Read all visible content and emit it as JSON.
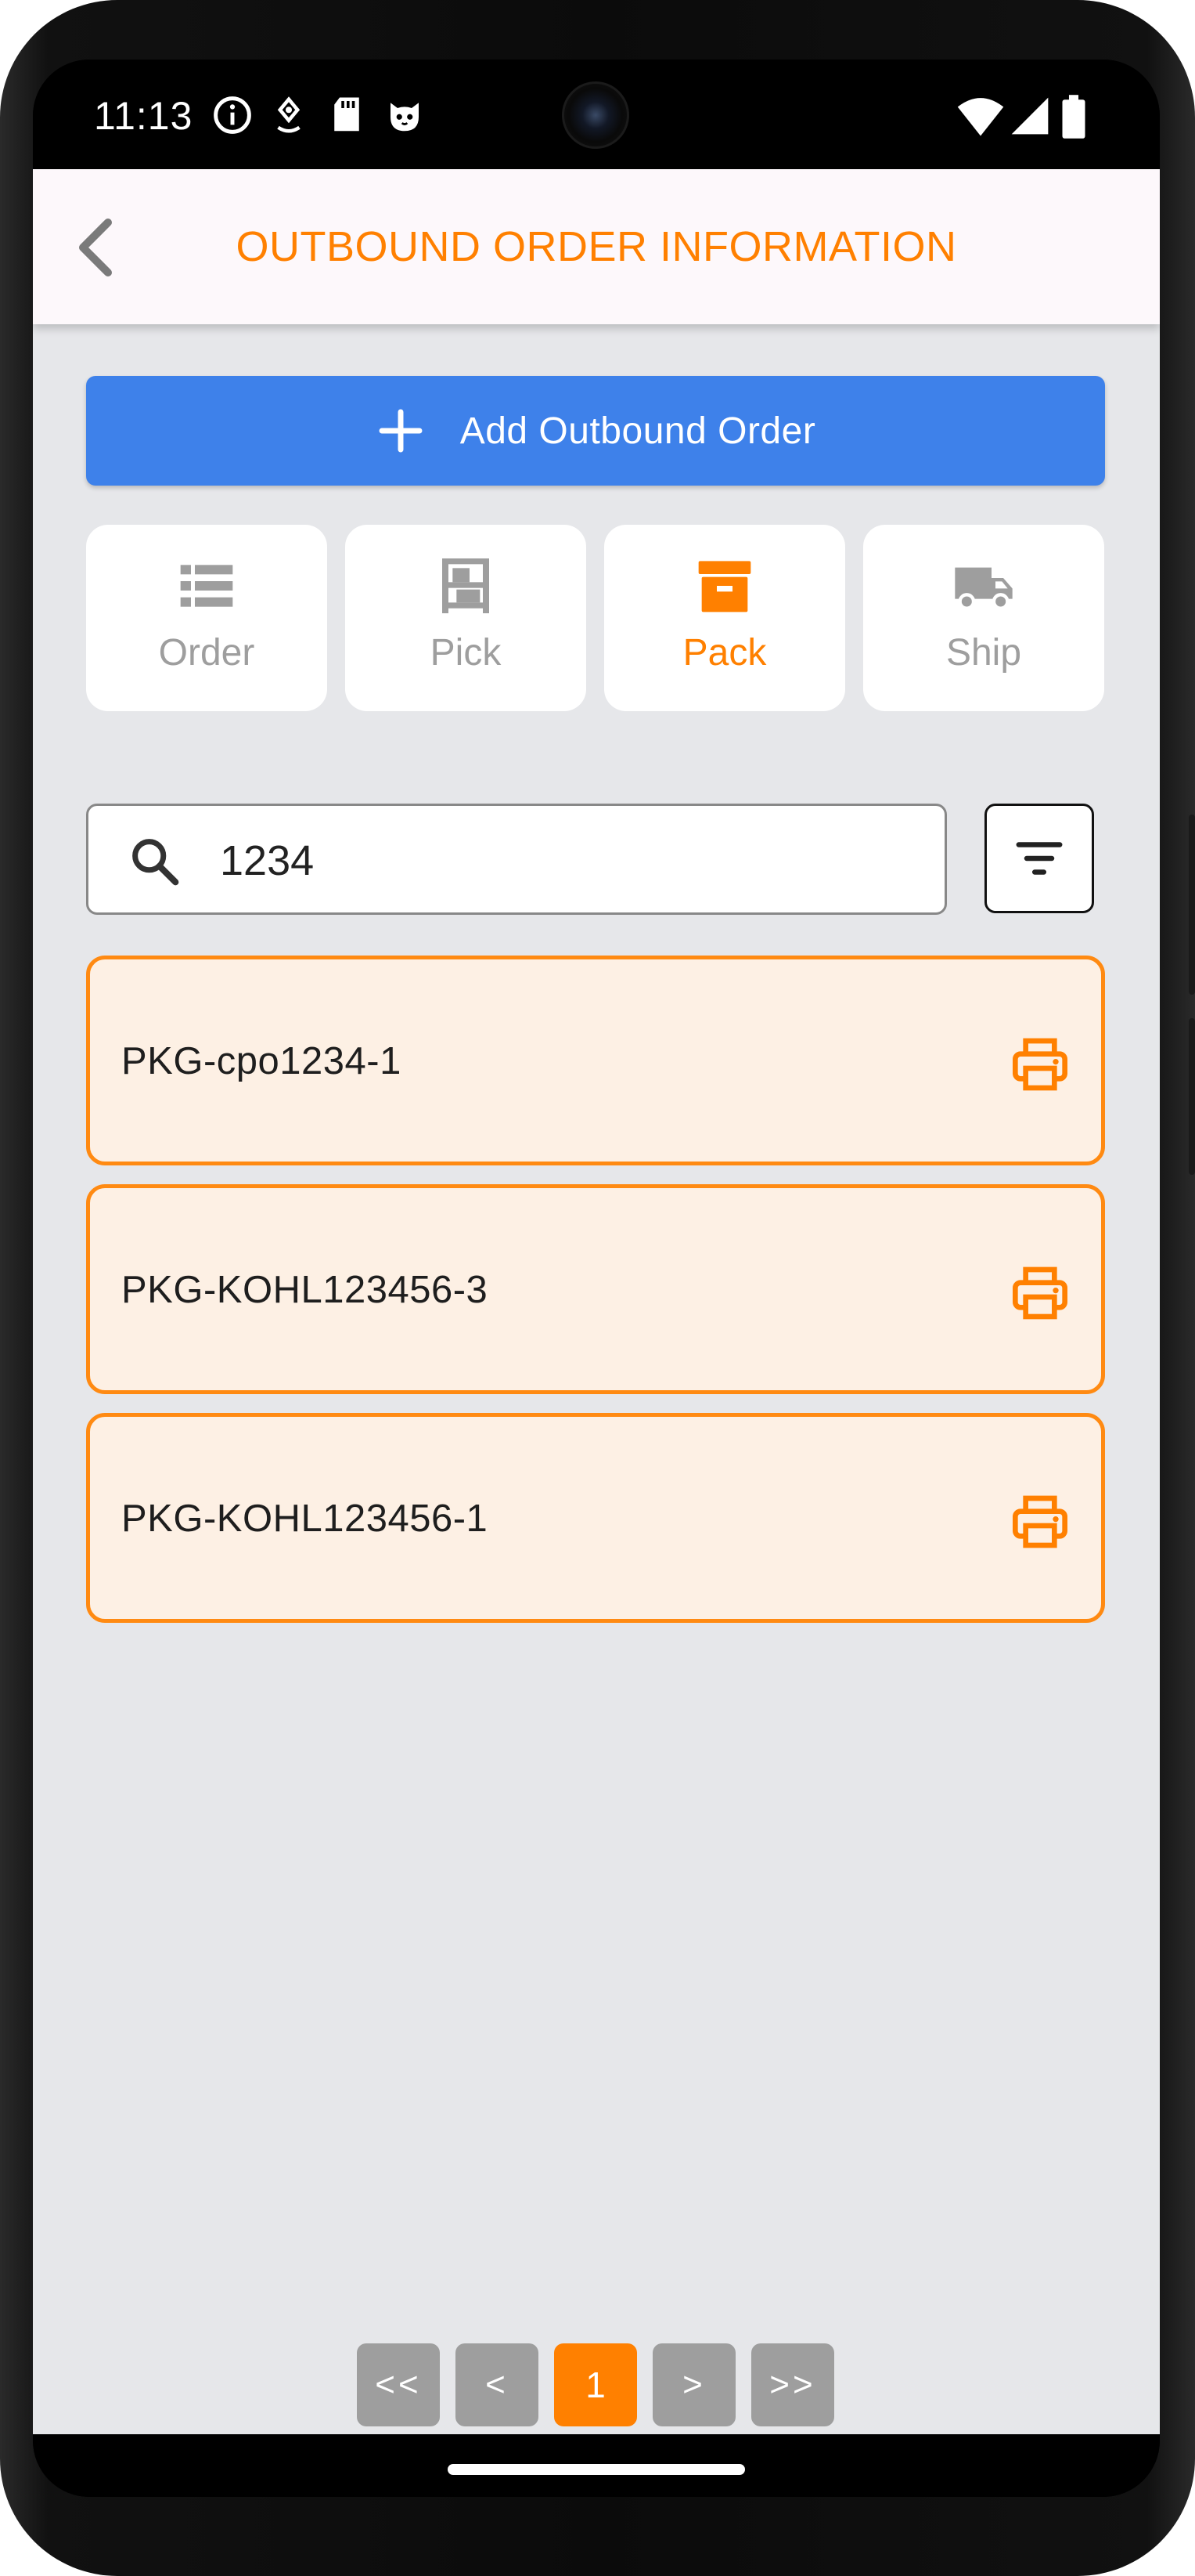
{
  "status_bar": {
    "time": "11:13",
    "left_icons": [
      "info-icon",
      "location-pin-icon",
      "sd-card-icon",
      "cat-face-icon"
    ],
    "right_icons": [
      "wifi-icon",
      "signal-icon",
      "battery-icon"
    ]
  },
  "app_bar": {
    "title": "OUTBOUND ORDER INFORMATION",
    "back_icon": "chevron-left-icon"
  },
  "add_button": {
    "label": "Add Outbound Order",
    "icon": "plus-icon"
  },
  "tabs": [
    {
      "label": "Order",
      "icon": "list-icon",
      "active": false
    },
    {
      "label": "Pick",
      "icon": "shelf-icon",
      "active": false
    },
    {
      "label": "Pack",
      "icon": "archive-box-icon",
      "active": true
    },
    {
      "label": "Ship",
      "icon": "truck-icon",
      "active": false
    }
  ],
  "search": {
    "value": "1234",
    "placeholder": ""
  },
  "packages": [
    {
      "label": "PKG-cpo1234-1",
      "action_icon": "printer-icon"
    },
    {
      "label": "PKG-KOHL123456-3",
      "action_icon": "printer-icon"
    },
    {
      "label": "PKG-KOHL123456-1",
      "action_icon": "printer-icon"
    }
  ],
  "pagination": {
    "first": "<<",
    "prev": "<",
    "current": "1",
    "next": ">",
    "last": ">>"
  },
  "colors": {
    "accent": "#ff8000",
    "primary_button": "#3e81ea",
    "background": "#e6e7ea",
    "card_background": "#fdf0e4",
    "card_border": "#ff8a12",
    "inactive_icon": "#9e9e9e"
  }
}
